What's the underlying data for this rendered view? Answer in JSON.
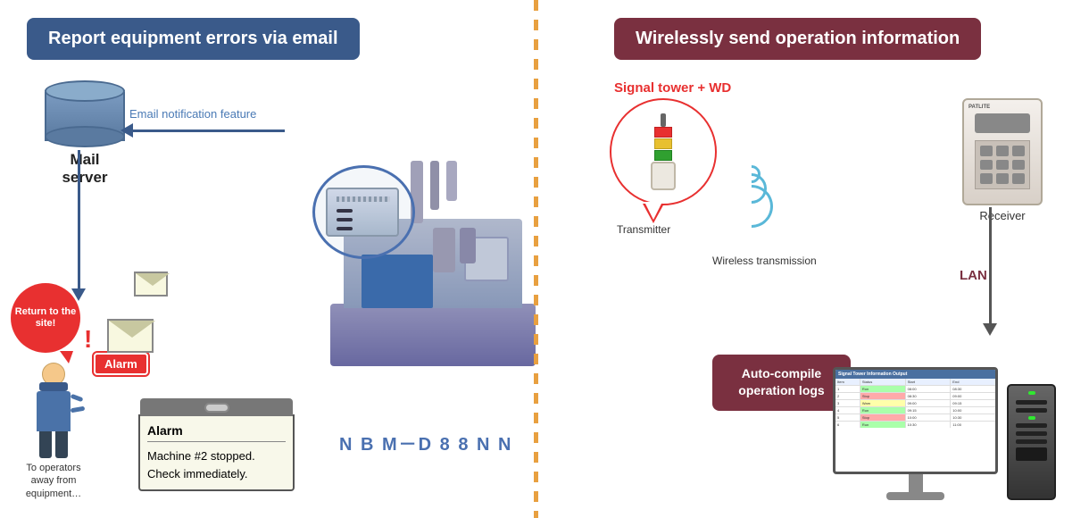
{
  "left": {
    "header": "Report equipment errors via email",
    "mail_server_label": "Mail\nserver",
    "email_notif_label": "Email notification feature",
    "speech_bubble": "Return\nto the\nsite!",
    "alarm_badge": "Alarm",
    "alarm_note_title": "Alarm",
    "alarm_note_line1": "Machine #2 stopped.",
    "alarm_note_line2": "Check immediately.",
    "person_label": "To operators\naway from\nequipment…"
  },
  "center": {
    "nbm_label": "N B M－D 8 8 N N"
  },
  "right": {
    "header": "Wirelessly send operation information",
    "signal_tower_label": "Signal tower + WD",
    "transmitter_label": "Transmitter",
    "wireless_label": "Wireless transmission",
    "lan_label": "LAN",
    "receiver_label": "Receiver",
    "receiver_brand": "PATLITE",
    "auto_compile_label": "Auto-compile\noperation logs",
    "monitor_header": "Signal Tower Information Output"
  }
}
